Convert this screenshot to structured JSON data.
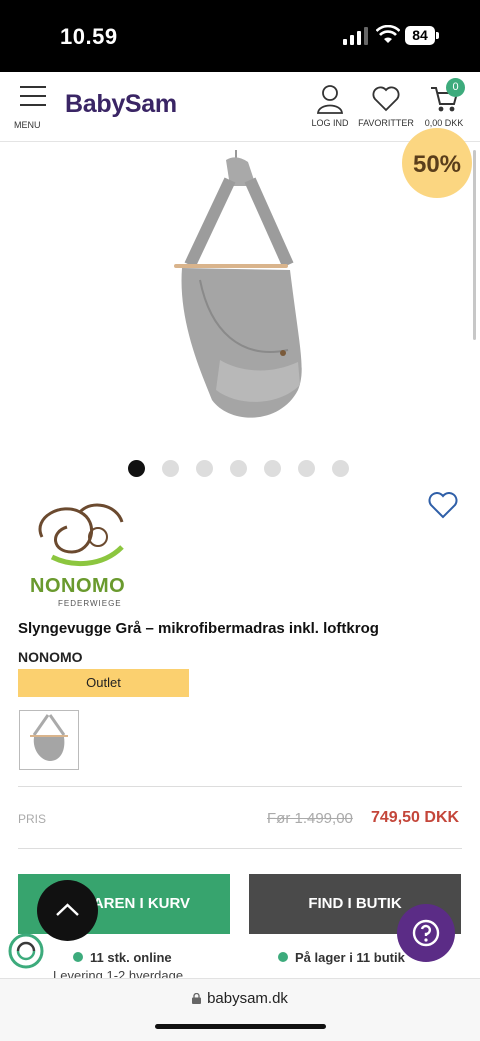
{
  "status_bar": {
    "time": "10.59",
    "battery": "84"
  },
  "header": {
    "menu_label": "MENU",
    "logo": "BabySam",
    "login_label": "LOG IND",
    "favorites_label": "FAVORITTER",
    "cart_label": "0,00 DKK",
    "cart_count": "0"
  },
  "gallery": {
    "discount": "50%",
    "dot_count": 7,
    "active_dot": 0
  },
  "product": {
    "brand_logo_text": "NONOMO",
    "brand_logo_sub": "FEDERWIEGE",
    "title": "Slyngevugge Grå – mikrofibermadras inkl. loftkrog",
    "brand": "NONOMO",
    "badge": "Outlet",
    "price_label": "PRIS",
    "old_price": "Før 1.499,00",
    "new_price": "749,50 DKK"
  },
  "actions": {
    "add_to_cart": "VAREN I KURV",
    "find_in_store": "FIND I BUTIK"
  },
  "availability": {
    "online": "11 stk. online",
    "store": "På lager i 11 butik",
    "delivery": "Levering 1-2 hverdage"
  },
  "browser": {
    "url": "babysam.dk"
  },
  "colors": {
    "brand_purple": "#3a2565",
    "green": "#37a46e",
    "price_red": "#c4463a",
    "outlet_yellow": "#fbd06f",
    "help_purple": "#5b2c86"
  }
}
